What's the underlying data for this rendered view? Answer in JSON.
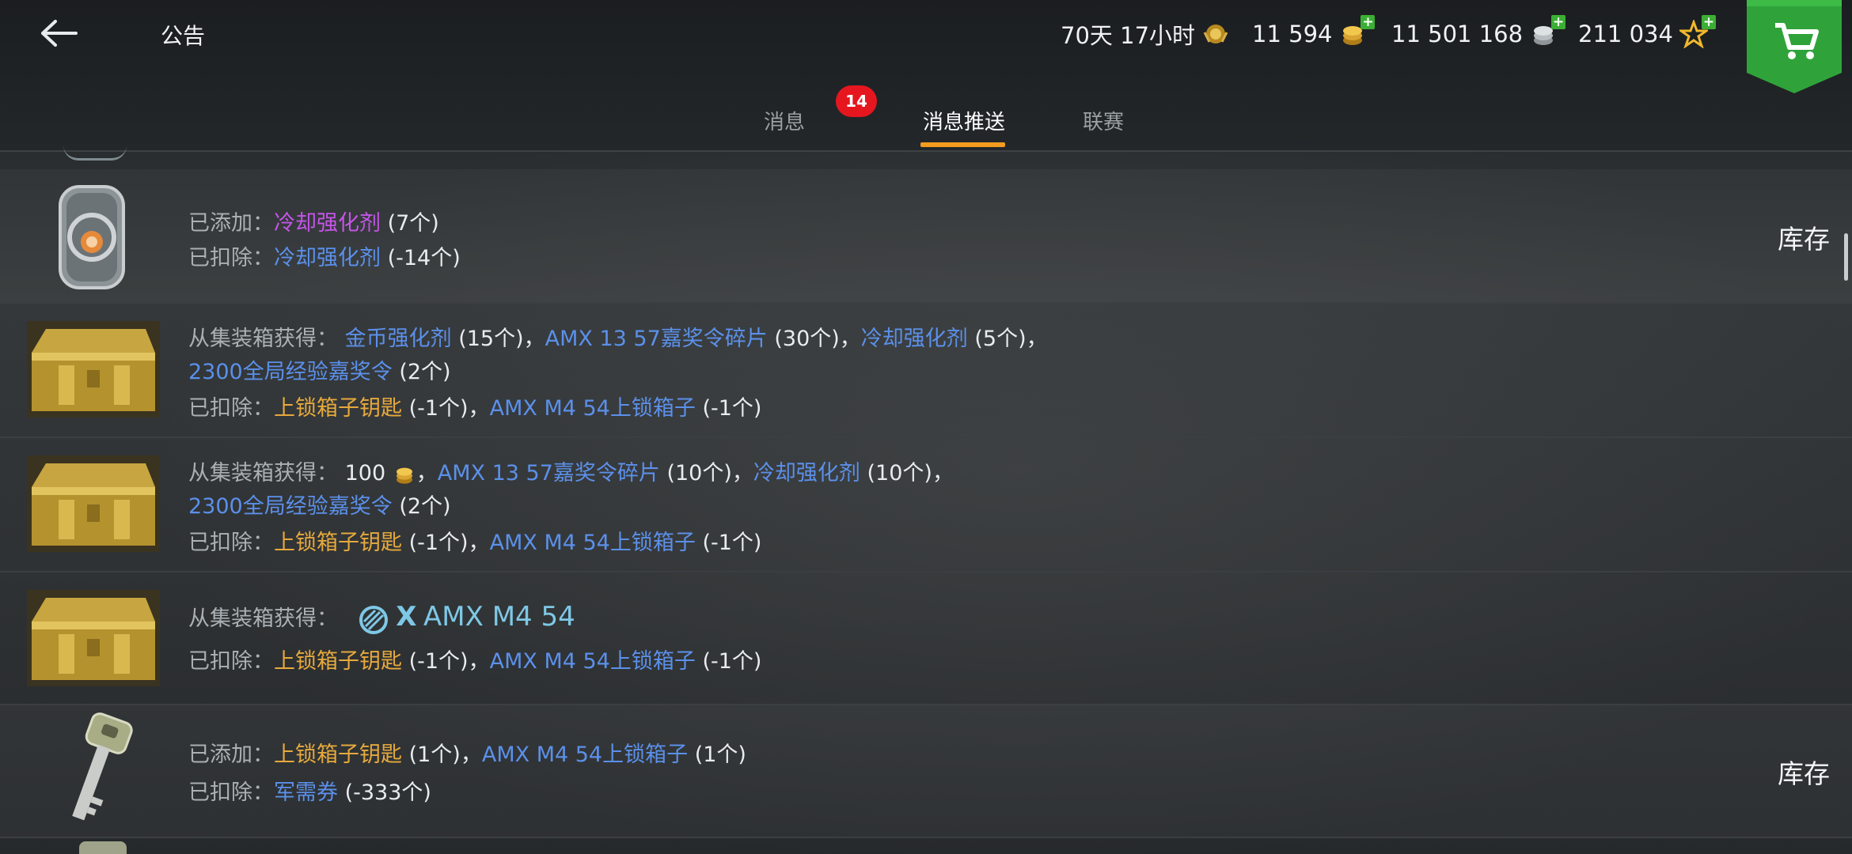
{
  "header": {
    "title": "公告",
    "timer": "70天 17小时",
    "gold": "11 594",
    "credits": "11 501 168",
    "free_xp": "211 034"
  },
  "tabs": [
    {
      "label": "消息",
      "badge": "14"
    },
    {
      "label": "消息推送",
      "active": true
    },
    {
      "label": "联赛"
    }
  ],
  "rows": [
    {
      "icon": "coolant-booster-icon",
      "line1": {
        "label": "已添加：",
        "item": "冷却强化剂",
        "qty": "(7个)"
      },
      "line2": {
        "label": "已扣除：",
        "item": "冷却强化剂",
        "qty": "(-14个)"
      },
      "action": "库存"
    },
    {
      "icon": "gold-container-icon",
      "line1": {
        "label": "从集装箱获得：",
        "i1": "金币强化剂",
        "q1": "(15个)",
        "sep1": "，",
        "i2": "AMX 13 57嘉奖令碎片",
        "q2": "(30个)",
        "sep2": "，",
        "i3": "冷却强化剂",
        "q3": "(5个)",
        "sep3": "，"
      },
      "line2": {
        "i1": "2300全局经验嘉奖令",
        "q1": "(2个)"
      },
      "line3": {
        "label": "已扣除：",
        "i1": "上锁箱子钥匙",
        "q1": "(-1个)",
        "sep": "，",
        "i2": "AMX M4 54上锁箱子",
        "q2": "(-1个)"
      }
    },
    {
      "icon": "gold-container-icon",
      "line1": {
        "label": "从集装箱获得：",
        "amount": "100",
        "sep0": "，",
        "i2": "AMX 13 57嘉奖令碎片",
        "q2": "(10个)",
        "sep2": "，",
        "i3": "冷却强化剂",
        "q3": "(10个)",
        "sep3": "，"
      },
      "line2": {
        "i1": "2300全局经验嘉奖令",
        "q1": "(2个)"
      },
      "line3": {
        "label": "已扣除：",
        "i1": "上锁箱子钥匙",
        "q1": "(-1个)",
        "sep": "，",
        "i2": "AMX M4 54上锁箱子",
        "q2": "(-1个)"
      }
    },
    {
      "icon": "gold-container-icon",
      "line1": {
        "label": "从集装箱获得：",
        "tier": "X",
        "tank": "AMX M4 54"
      },
      "line2": {
        "label": "已扣除：",
        "i1": "上锁箱子钥匙",
        "q1": "(-1个)",
        "sep": "，",
        "i2": "AMX M4 54上锁箱子",
        "q2": "(-1个)"
      }
    },
    {
      "icon": "key-icon",
      "line1": {
        "label": "已添加：",
        "i1": "上锁箱子钥匙",
        "q1": "(1个)",
        "sep": "，",
        "i2": "AMX M4 54上锁箱子",
        "q2": "(1个)"
      },
      "line2": {
        "label": "已扣除：",
        "i1": "军需券",
        "q1": "(-333个)"
      },
      "action": "库存"
    }
  ],
  "colors": {
    "accent": "#f39c1f",
    "badge": "#e6161f",
    "item_blue": "#5b90ea",
    "item_purple": "#c455e8",
    "item_gold": "#e6a93d",
    "plus_green": "#3cae35",
    "shop_green": "#2fa33a"
  }
}
